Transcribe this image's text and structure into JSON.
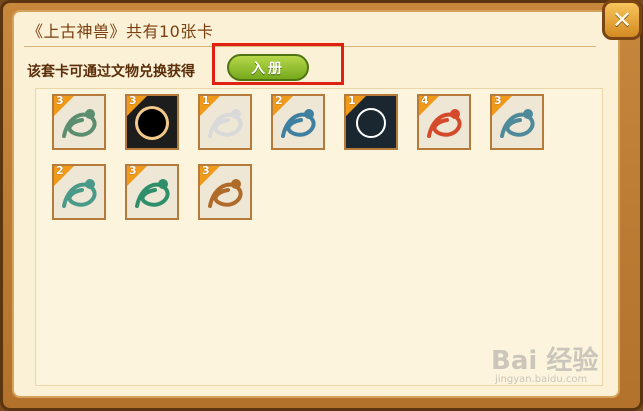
{
  "window": {
    "title": "《上古神兽》共有10张卡",
    "subtitle": "该套卡可通过文物兑换获得",
    "enter_button_label": "入册",
    "close_icon": "close-icon"
  },
  "cards": [
    {
      "stars": "3",
      "creature": "dragon-turtle",
      "style": "light",
      "accent": "#5b8e6f"
    },
    {
      "stars": "3",
      "creature": "dark-orb",
      "style": "dark",
      "accent": "#000000"
    },
    {
      "stars": "1",
      "creature": "white-tiger",
      "style": "light",
      "accent": "#d9d9d9"
    },
    {
      "stars": "2",
      "creature": "winged-serpent",
      "style": "light",
      "accent": "#3f7fa0"
    },
    {
      "stars": "1",
      "creature": "ring-orb",
      "style": "dark",
      "accent": "#ffffff"
    },
    {
      "stars": "4",
      "creature": "phoenix",
      "style": "light",
      "accent": "#d44a2a"
    },
    {
      "stars": "3",
      "creature": "qilin",
      "style": "light",
      "accent": "#4f8a9a"
    },
    {
      "stars": "2",
      "creature": "azure-dragon",
      "style": "light",
      "accent": "#4a9a8a"
    },
    {
      "stars": "3",
      "creature": "green-dragon",
      "style": "light",
      "accent": "#2f8f6a"
    },
    {
      "stars": "3",
      "creature": "golden-dragon",
      "style": "light",
      "accent": "#b06a2a"
    }
  ],
  "watermark": {
    "brand": "Bai 经验",
    "sub": "jingyan.baidu.com"
  }
}
